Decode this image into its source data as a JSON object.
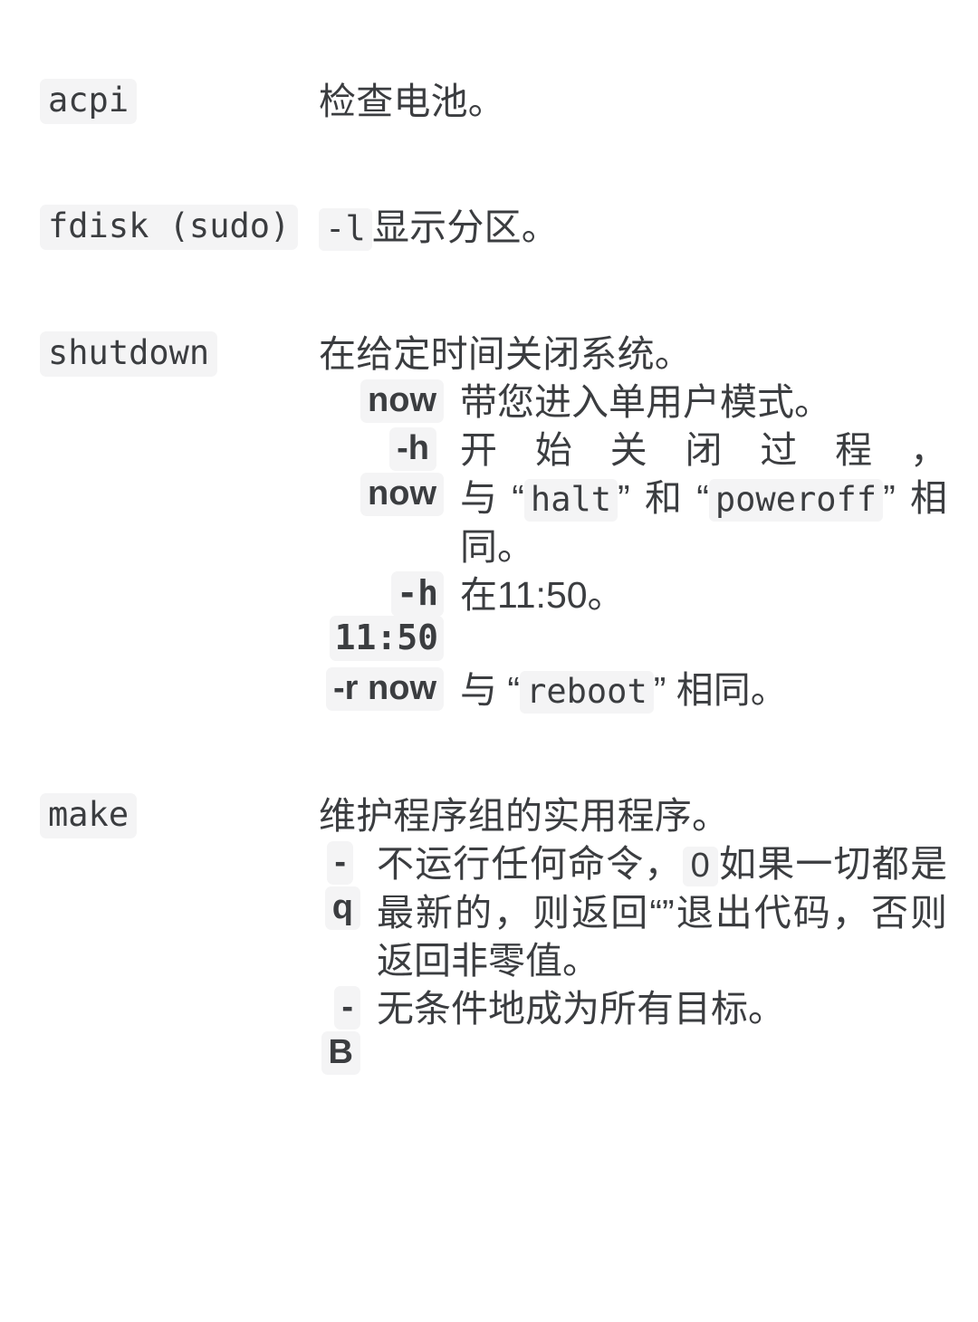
{
  "document": {
    "type": "linux-command-reference",
    "language": "zh-CN",
    "background_color": "#ffffff",
    "text_color": "#3b3d40",
    "code_background_color": "#f4f4f5"
  },
  "entries": [
    {
      "id": "acpi",
      "command": "acpi",
      "description": "检查电池。",
      "options": []
    },
    {
      "id": "fdisk",
      "command": "fdisk (sudo)",
      "description_code": "-l",
      "description_rest": "显示分区。",
      "options": []
    },
    {
      "id": "shutdown",
      "command": "shutdown",
      "description": "在给定时间关闭系统。",
      "options": [
        {
          "key": "now",
          "desc": "带您进入单用户模式。"
        },
        {
          "key": "-h now",
          "desc_parts": [
            {
              "text": "开始关闭过程，与",
              "kind": "text"
            },
            {
              "text": "“",
              "kind": "quote"
            },
            {
              "text": "halt",
              "kind": "code"
            },
            {
              "text": "”",
              "kind": "quote"
            },
            {
              "text": "和",
              "kind": "text"
            },
            {
              "text": "“",
              "kind": "quote"
            },
            {
              "text": "poweroff",
              "kind": "code"
            },
            {
              "text": "”",
              "kind": "quote"
            },
            {
              "text": "相同。",
              "kind": "text"
            }
          ]
        },
        {
          "key": "-h 11:50",
          "desc": "在11:50。"
        },
        {
          "key": "-r now",
          "desc_parts": [
            {
              "text": "与",
              "kind": "text"
            },
            {
              "text": "“",
              "kind": "quote"
            },
            {
              "text": "reboot",
              "kind": "code"
            },
            {
              "text": "”",
              "kind": "quote"
            },
            {
              "text": "相同。",
              "kind": "text"
            }
          ]
        }
      ]
    },
    {
      "id": "make",
      "command": "make",
      "description": "维护程序组的实用程序。",
      "options": [
        {
          "key": "-q",
          "desc_parts": [
            {
              "text": "不运行任何命令，",
              "kind": "text"
            },
            {
              "text": "0",
              "kind": "code-sans"
            },
            {
              "text": "如果一切都是最新的，则返回“”退出代码，否则返回非零值。",
              "kind": "text"
            }
          ]
        },
        {
          "key": "-B",
          "desc": "无条件地成为所有目标。"
        }
      ]
    }
  ],
  "strings": {
    "acpi_cmd": "acpi",
    "acpi_desc": "检查电池。",
    "fdisk_cmd": "fdisk (sudo)",
    "fdisk_code": "-l",
    "fdisk_desc": "显示分区。",
    "shutdown_cmd": "shutdown",
    "shutdown_desc": "在给定时间关闭系统。",
    "opt_now": "now",
    "opt_now_desc": "带您进入单用户模式。",
    "opt_h_now": "-h now",
    "opt_h_now_a": "开始关闭过程，与",
    "opt_h_now_code1": "halt",
    "opt_h_now_b": "和",
    "opt_h_now_code2": "poweroff",
    "opt_h_now_c": "相同。",
    "opt_h_time": "-h 11:50",
    "opt_h_time_desc": "在11:50。",
    "opt_r_now": "-r now",
    "opt_r_now_a": "与",
    "opt_r_now_code": "reboot",
    "opt_r_now_b": "相同。",
    "make_cmd": "make",
    "make_desc": "维护程序组的实用程序。",
    "opt_q": "-q",
    "opt_q_a": "不运行任何命令，",
    "opt_q_code": "0",
    "opt_q_b": "如果一切都是最新的，则返回",
    "opt_q_c": "退出代码，否则返回非零值。",
    "opt_B": "-B",
    "opt_B_desc": "无条件地成为所有目标。",
    "quote_open": "“",
    "quote_close": "”"
  }
}
